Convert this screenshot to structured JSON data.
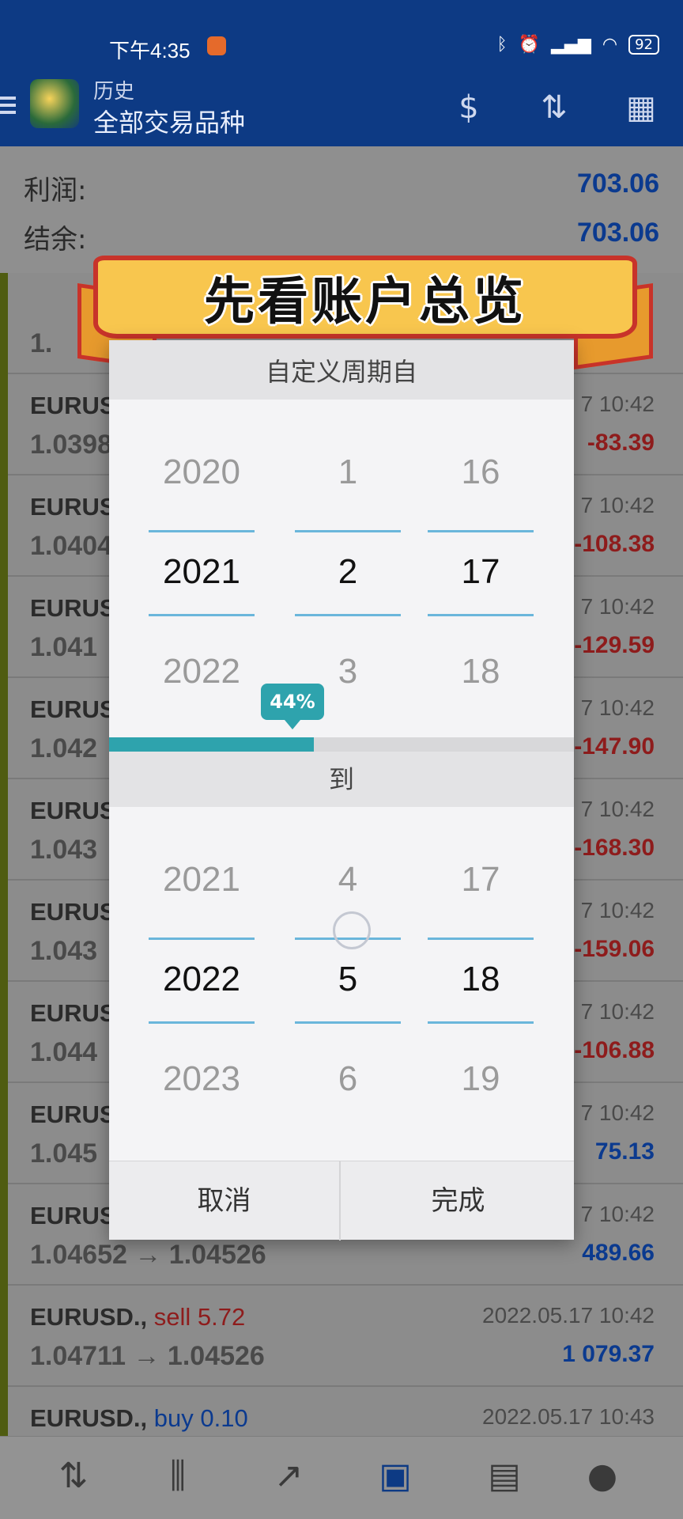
{
  "status_bar": {
    "time": "下午4:35",
    "battery": "92"
  },
  "app_bar": {
    "subtitle": "历史",
    "title": "全部交易品种"
  },
  "summary": {
    "profit_label": "利润:",
    "profit_value": "703.06",
    "balance_label": "结余:",
    "balance_value": "703.06"
  },
  "trades": [
    {
      "symbol": "",
      "side": "",
      "prices": "1.",
      "date": "",
      "profit": ""
    },
    {
      "symbol": "EURUS",
      "side": "",
      "prices": "1.0398",
      "date": "7 10:42",
      "profit": "-83.39",
      "profit_type": "neg"
    },
    {
      "symbol": "EURUS",
      "side": "",
      "prices": "1.0404",
      "date": "7 10:42",
      "profit": "-108.38",
      "profit_type": "neg"
    },
    {
      "symbol": "EURUS",
      "side": "",
      "prices": "1.041",
      "date": "7 10:42",
      "profit": "-129.59",
      "profit_type": "neg"
    },
    {
      "symbol": "EURUS",
      "side": "",
      "prices": "1.042",
      "date": "7 10:42",
      "profit": "-147.90",
      "profit_type": "neg"
    },
    {
      "symbol": "EURUS",
      "side": "",
      "prices": "1.043",
      "date": "7 10:42",
      "profit": "-168.30",
      "profit_type": "neg"
    },
    {
      "symbol": "EURUS",
      "side": "",
      "prices": "1.043",
      "date": "7 10:42",
      "profit": "-159.06",
      "profit_type": "neg"
    },
    {
      "symbol": "EURUS",
      "side": "",
      "prices": "1.044",
      "date": "7 10:42",
      "profit": "-106.88",
      "profit_type": "neg"
    },
    {
      "symbol": "EURUS",
      "side": "",
      "prices": "1.045",
      "date": "7 10:42",
      "profit": "75.13",
      "profit_type": "pos"
    },
    {
      "symbol": "EURUS",
      "side": "",
      "prices": "1.04652 → 1.04526",
      "date": "7 10:42",
      "profit": "489.66",
      "profit_type": "pos"
    },
    {
      "symbol": "EURUSD.,",
      "side": "sell 5.72",
      "side_type": "sell",
      "prices": "1.04711 → 1.04526",
      "date": "2022.05.17 10:42",
      "profit": "1 079.37",
      "profit_type": "pos"
    },
    {
      "symbol": "EURUSD.,",
      "side": "buy 0.10",
      "side_type": "buy",
      "prices": "",
      "date": "2022.05.17 10:43",
      "profit": ""
    }
  ],
  "banner_text": "先看账户总览",
  "dialog": {
    "header": "自定义周期自",
    "from_picker": {
      "year": [
        "2020",
        "2021",
        "2022"
      ],
      "month": [
        "1",
        "2",
        "3"
      ],
      "day": [
        "16",
        "17",
        "18"
      ]
    },
    "progress_label": "44%",
    "progress_value": 0.44,
    "mid_label": "到",
    "to_picker": {
      "year": [
        "2021",
        "2022",
        "2023"
      ],
      "month": [
        "4",
        "5",
        "6"
      ],
      "day": [
        "17",
        "18",
        "19"
      ]
    },
    "cancel_label": "取消",
    "done_label": "完成"
  },
  "bottom_nav": [
    {
      "icon": "quotes-icon"
    },
    {
      "icon": "chart-candles-icon"
    },
    {
      "icon": "trade-icon"
    },
    {
      "icon": "history-inbox-icon",
      "active": true
    },
    {
      "icon": "news-icon"
    },
    {
      "icon": "chat-icon"
    }
  ]
}
